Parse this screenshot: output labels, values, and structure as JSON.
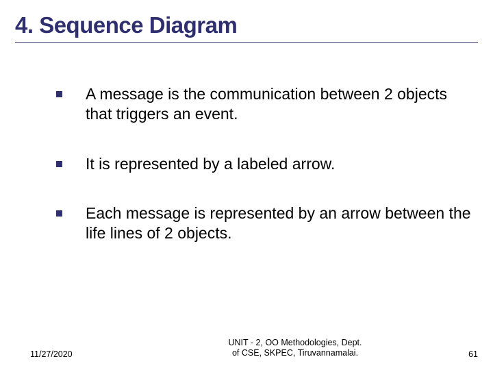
{
  "title": "4. Sequence Diagram",
  "bullets": [
    "A message is the communication between 2 objects that triggers an event.",
    "It is represented by a labeled arrow.",
    "Each message is represented by an arrow between the life lines of 2 objects."
  ],
  "footer": {
    "date": "11/27/2020",
    "center_line1": "UNIT - 2, OO Methodologies, Dept.",
    "center_line2": "of CSE, SKPEC, Tiruvannamalai.",
    "page": "61"
  }
}
